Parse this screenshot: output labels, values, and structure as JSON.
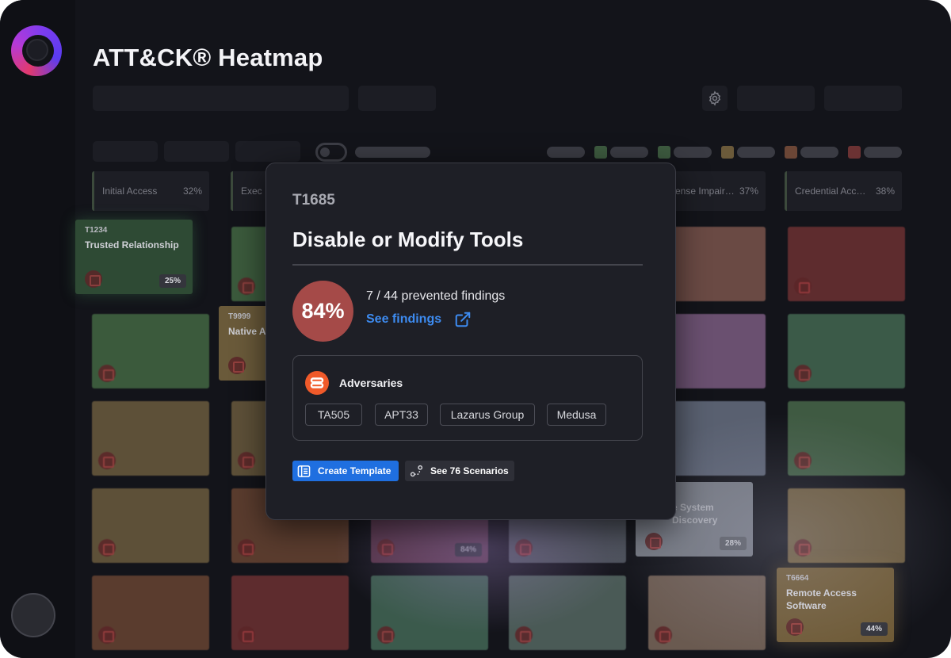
{
  "header": {
    "title": "ATT&CK® Heatmap"
  },
  "tactics": [
    {
      "label": "Initial Access",
      "pct": "32%"
    },
    {
      "label": "Exec",
      "pct": ""
    },
    {
      "label": "ense Impair…",
      "pct": "37%"
    },
    {
      "label": "Credential Acc…",
      "pct": "38%"
    }
  ],
  "tiles": [
    {
      "code": "T1234",
      "name": "Trusted Relationship",
      "pct": "25%"
    },
    {
      "code": "T9999",
      "name": "Native A",
      "pct": ""
    },
    {
      "code": "",
      "name": "",
      "pct": "84%"
    },
    {
      "code": "",
      "name": "e System Discovery",
      "pct": "28%"
    },
    {
      "code": "T6664",
      "name": "Remote Access Software",
      "pct": "44%"
    }
  ],
  "modal": {
    "code": "T1685",
    "title": "Disable or Modify Tools",
    "score": "84%",
    "findings_text": "7 / 44 prevented findings",
    "see_findings": "See findings",
    "adversaries_label": "Adversaries",
    "adversaries": [
      "TA505",
      "APT33",
      "Lazarus Group",
      "Medusa"
    ],
    "create_template": "Create Template",
    "see_scenarios": "See 76 Scenarios"
  },
  "colors": {
    "background": "#13141a",
    "score_red": "#a54a48",
    "link_blue": "#3d8bf0",
    "primary_button": "#1f6fe0",
    "adversary_orange": "#f05a2a"
  },
  "icons": [
    "logo-icon",
    "gear-icon",
    "external-link-icon",
    "adversary-icon",
    "template-icon",
    "scenarios-icon"
  ]
}
